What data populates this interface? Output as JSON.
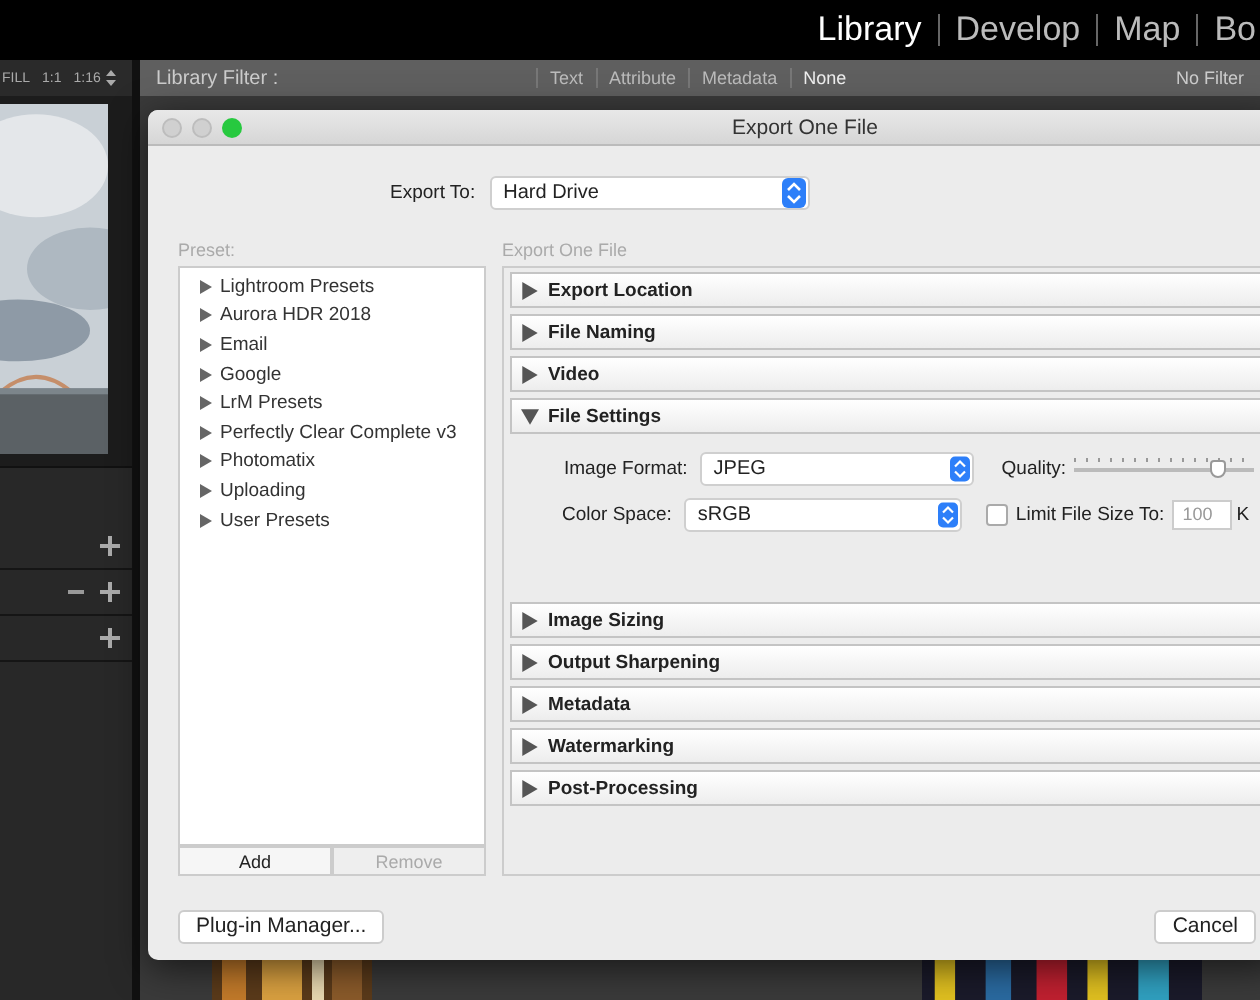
{
  "modules": [
    {
      "label": "Library",
      "selected": true
    },
    {
      "label": "Develop",
      "selected": false
    },
    {
      "label": "Map",
      "selected": false
    },
    {
      "label": "Bo",
      "selected": false
    }
  ],
  "toolbar": {
    "fill": "FILL",
    "one_to_one": "1:1",
    "zoom": "1:16"
  },
  "library_filter": {
    "label": "Library Filter :",
    "options": [
      {
        "label": "Text",
        "selected": false
      },
      {
        "label": "Attribute",
        "selected": false
      },
      {
        "label": "Metadata",
        "selected": false
      },
      {
        "label": "None",
        "selected": true
      }
    ],
    "preset": "No Filter"
  },
  "left_panel_rows": [
    {
      "has_minus": false
    },
    {
      "has_minus": true
    },
    {
      "has_minus": false
    }
  ],
  "dialog": {
    "title": "Export One File",
    "export_to_label": "Export To:",
    "export_to": "Hard Drive",
    "preset_label": "Preset:",
    "presets": [
      {
        "label": "Lightroom Presets",
        "expanded": false
      },
      {
        "label": "Aurora HDR 2018",
        "expanded": false
      },
      {
        "label": "Email",
        "expanded": false
      },
      {
        "label": "Google",
        "expanded": false
      },
      {
        "label": "LrM Presets",
        "expanded": false
      },
      {
        "label": "Perfectly Clear Complete v3",
        "expanded": false
      },
      {
        "label": "Photomatix",
        "expanded": false
      },
      {
        "label": "Uploading",
        "expanded": false
      },
      {
        "label": "User Presets",
        "expanded": false
      }
    ],
    "preset_buttons": [
      {
        "label": "Add",
        "disabled": false
      },
      {
        "label": "Remove",
        "disabled": true
      }
    ],
    "breadcrumb": "Export One File",
    "sections": [
      {
        "title": "Export Location",
        "expanded": false
      },
      {
        "title": "File Naming",
        "expanded": false
      },
      {
        "title": "Video",
        "expanded": false
      },
      {
        "title": "File Settings",
        "expanded": true,
        "settings": {
          "image_format_label": "Image Format:",
          "image_format": "JPEG",
          "quality_label": "Quality:",
          "level": 0.8,
          "color_space_label": "Color Space:",
          "color_space": "sRGB",
          "limit_checked": false,
          "limit_label": "Limit File Size To:",
          "limit_value": "100",
          "limit_unit": "K"
        }
      },
      {
        "title": "Image Sizing",
        "expanded": false
      },
      {
        "title": "Output Sharpening",
        "expanded": false
      },
      {
        "title": "Metadata",
        "expanded": false
      },
      {
        "title": "Watermarking",
        "expanded": false
      },
      {
        "title": "Post-Processing",
        "expanded": false
      }
    ],
    "plugin_manager": "Plug-in Manager...",
    "cancel": "Cancel"
  }
}
